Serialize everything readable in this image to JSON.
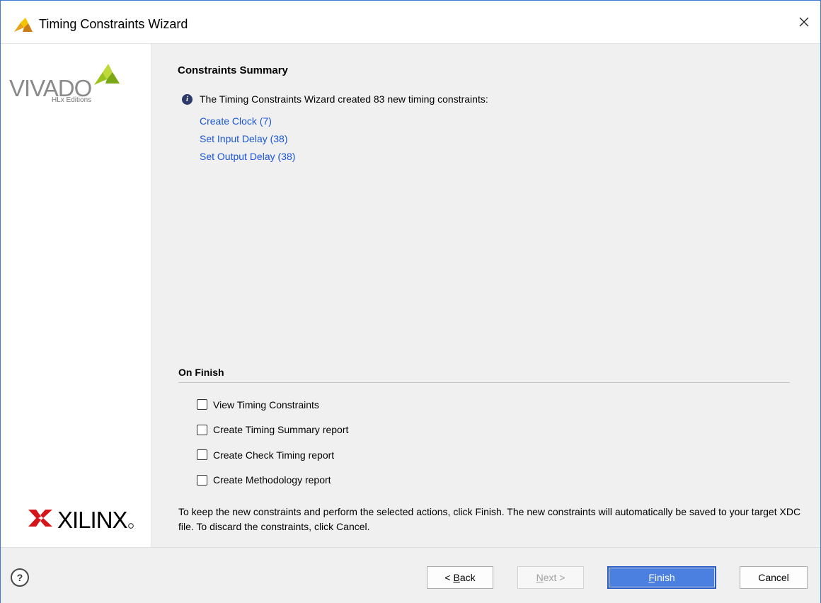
{
  "window": {
    "title": "Timing Constraints Wizard",
    "accent_color": "#3d7ad6"
  },
  "sidebar": {
    "vivado_logo_text": "VIVADO",
    "vivado_logo_subtext": "HLx Editions",
    "xilinx_logo_text": "XILINX"
  },
  "main": {
    "section_title": "Constraints Summary",
    "info_text": "The Timing Constraints Wizard created 83 new timing constraints:",
    "links": [
      "Create Clock (7)",
      "Set Input Delay (38)",
      "Set Output Delay (38)"
    ],
    "on_finish_heading": "On Finish",
    "options": [
      {
        "label": "View Timing Constraints",
        "checked": false
      },
      {
        "label": "Create Timing Summary report",
        "checked": false
      },
      {
        "label": "Create Check Timing report",
        "checked": false
      },
      {
        "label": "Create Methodology report",
        "checked": false
      }
    ],
    "note": "To keep the new constraints and perform the selected actions, click Finish. The new constraints will automatically be saved to your target XDC file. To discard the constraints, click Cancel."
  },
  "footer": {
    "help_label": "?",
    "back_prefix": "< ",
    "back_label": "B",
    "back_suffix": "ack",
    "next_label": "N",
    "next_suffix": "ext >",
    "finish_label": "F",
    "finish_suffix": "inish",
    "cancel_label": "Cancel"
  },
  "colors": {
    "link": "#1a55d8",
    "primary_button": "#4b7fe0",
    "vivado_green": "#9ac31c",
    "xilinx_red": "#d4161a"
  }
}
